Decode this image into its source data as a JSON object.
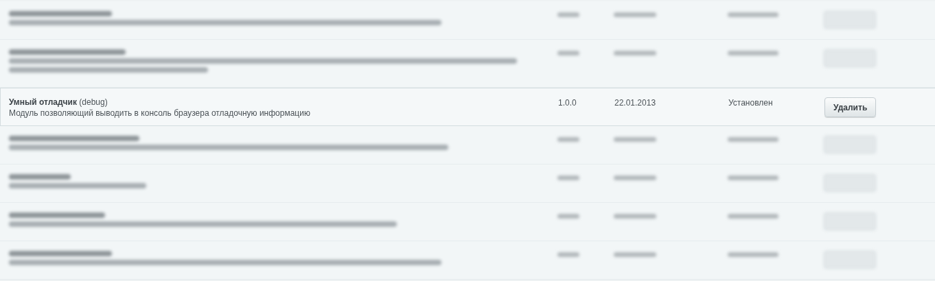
{
  "modules": [
    {
      "kind": "blurred"
    },
    {
      "kind": "blurred"
    },
    {
      "kind": "clear",
      "name": "Умный отладчик",
      "code": "(debug)",
      "description": "Модуль позволяющий выводить в консоль браузера отладочную информацию",
      "version": "1.0.0",
      "date": "22.01.2013",
      "status": "Установлен",
      "action": "Удалить"
    },
    {
      "kind": "blurred"
    },
    {
      "kind": "blurred"
    },
    {
      "kind": "blurred"
    },
    {
      "kind": "blurred"
    }
  ]
}
